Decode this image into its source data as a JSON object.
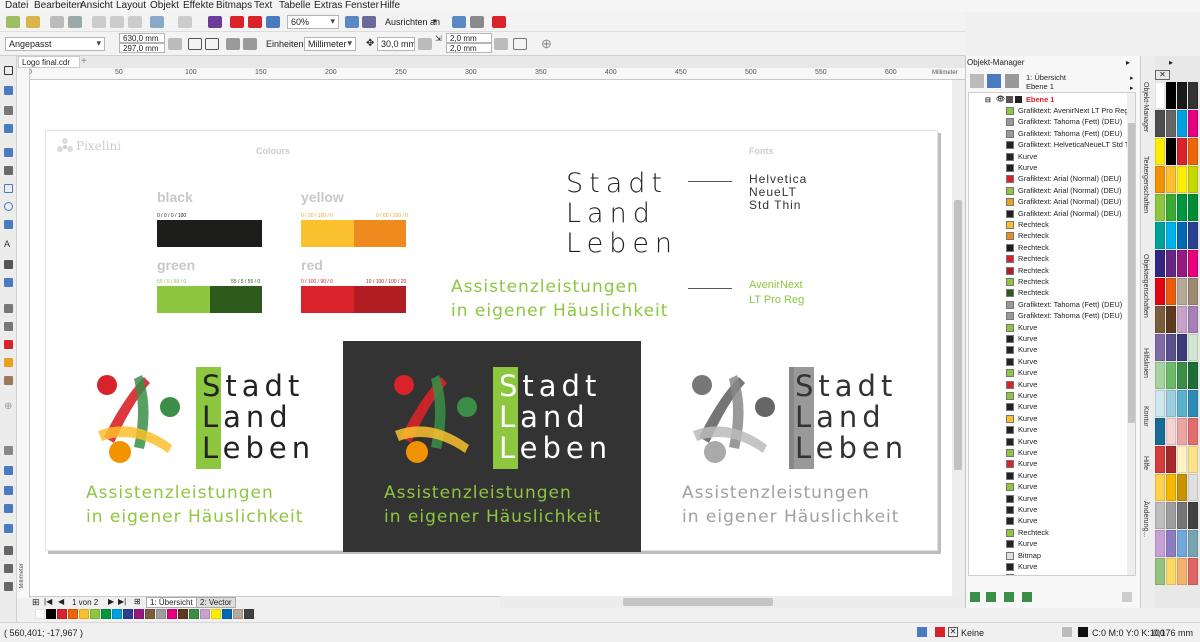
{
  "menu": [
    "Datei",
    "Bearbeiten",
    "Ansicht",
    "Layout",
    "Objekt",
    "Effekte",
    "Bitmaps",
    "Text",
    "Tabelle",
    "Extras",
    "Fenster",
    "Hilfe"
  ],
  "toolbar": {
    "zoom": "60%",
    "align": "Ausrichten an"
  },
  "propbar": {
    "preset": "Angepasst",
    "width": "630,0 mm",
    "height": "297,0 mm",
    "units_label": "Einheiten:",
    "units": "Millimeter",
    "nudge": "30,0 mm",
    "dup_x": "2,0 mm",
    "dup_y": "2,0 mm"
  },
  "doc_tab": "Logo final.cdr",
  "ruler": {
    "ticks": [
      "0",
      "50",
      "100",
      "150",
      "200",
      "250",
      "300",
      "350",
      "400",
      "450",
      "500",
      "550",
      "600"
    ],
    "unit": "Millimeter",
    "vunit": "Millimeter"
  },
  "pagenav": {
    "count": "1 von 2",
    "page1": "1: Übersicht",
    "page2": "2: Vector"
  },
  "status": {
    "coords": "( 560,401; -17,967 )",
    "fill_none": "Keine",
    "cmyk": "C:0 M:0 Y:0 K:100",
    "outline": "0,176 mm"
  },
  "sheet": {
    "brand": "Pixelini",
    "colours_title": "Colours",
    "fonts_title": "Fonts",
    "colours": [
      {
        "name": "black",
        "code1": "0 / 0 / 0 / 100",
        "code2": "",
        "c1": "#1d1d1b",
        "c2": "#1d1d1b",
        "codecolor": "#222"
      },
      {
        "name": "yellow",
        "code1": "0 / 20 / 100 / 0",
        "code2": "0 / 60 / 100 / 0",
        "c1": "#fbc02d",
        "c2": "#ef8a1f",
        "codecolor": "#e9a21f"
      },
      {
        "name": "green",
        "code1": "55 / 0 / 90 / 0",
        "code2": "55 / 5 / 55 / 0",
        "c1": "#8dc63f",
        "c2": "#2d5a1b",
        "codecolor": "#8dc63f"
      },
      {
        "name": "red",
        "code1": "0 / 100 / 90 / 0",
        "code2": "10 / 100 / 100 / 20",
        "c1": "#d8232a",
        "c2": "#b01e23",
        "codecolor": "#d8232a"
      }
    ],
    "logo_lines": [
      "Stadt",
      "Land",
      "Leben"
    ],
    "font1": [
      "Helvetica",
      "NeueLT",
      "Std Thin"
    ],
    "tagline": [
      "Assistenzleistungen",
      "in eigener Häuslichkeit"
    ],
    "font2": [
      "AvenirNext",
      "LT Pro Reg"
    ],
    "green": "#8dc63f",
    "gray": "#a0a0a0"
  },
  "object_manager": {
    "title": "Objekt-Manager",
    "page": "1: Übersicht",
    "layer": "Ebene 1",
    "layer_label": "Ebene 1",
    "items": [
      {
        "label": "Grafiktext: AvenirNext LT Pro Reg",
        "icon": "#8dc63f"
      },
      {
        "label": "Grafiktext: Tahoma (Fett) (DEU)",
        "icon": "#999"
      },
      {
        "label": "Grafiktext: Tahoma (Fett) (DEU)",
        "icon": "#999"
      },
      {
        "label": "Grafiktext: HelveticaNeueLT Std Th",
        "icon": "#222"
      },
      {
        "label": "Kurve",
        "icon": "#222"
      },
      {
        "label": "Kurve",
        "icon": "#222"
      },
      {
        "label": "Grafiktext: Arial (Normal) (DEU)",
        "icon": "#d8232a"
      },
      {
        "label": "Grafiktext: Arial (Normal) (DEU)",
        "icon": "#8dc63f"
      },
      {
        "label": "Grafiktext: Arial (Normal) (DEU)",
        "icon": "#e9a21f"
      },
      {
        "label": "Grafiktext: Arial (Normal) (DEU)",
        "icon": "#222"
      },
      {
        "label": "Rechteck",
        "icon": "#fbc02d"
      },
      {
        "label": "Rechteck",
        "icon": "#ef8a1f"
      },
      {
        "label": "Rechteck",
        "icon": "#1d1d1b"
      },
      {
        "label": "Rechteck",
        "icon": "#d8232a"
      },
      {
        "label": "Rechteck",
        "icon": "#b01e23"
      },
      {
        "label": "Rechteck",
        "icon": "#8dc63f"
      },
      {
        "label": "Rechteck",
        "icon": "#2d5a1b"
      },
      {
        "label": "Grafiktext: Tahoma (Fett) (DEU)",
        "icon": "#999"
      },
      {
        "label": "Grafiktext: Tahoma (Fett) (DEU)",
        "icon": "#999"
      },
      {
        "label": "Kurve",
        "icon": "#8dc63f"
      },
      {
        "label": "Kurve",
        "icon": "#222"
      },
      {
        "label": "Kurve",
        "icon": "#222"
      },
      {
        "label": "Kurve",
        "icon": "#222"
      },
      {
        "label": "Kurve",
        "icon": "#8dc63f"
      },
      {
        "label": "Kurve",
        "icon": "#d8232a"
      },
      {
        "label": "Kurve",
        "icon": "#8dc63f"
      },
      {
        "label": "Kurve",
        "icon": "#222"
      },
      {
        "label": "Kurve",
        "icon": "#fbc02d"
      },
      {
        "label": "Kurve",
        "icon": "#222"
      },
      {
        "label": "Kurve",
        "icon": "#222"
      },
      {
        "label": "Kurve",
        "icon": "#8dc63f"
      },
      {
        "label": "Kurve",
        "icon": "#d8232a"
      },
      {
        "label": "Kurve",
        "icon": "#222"
      },
      {
        "label": "Kurve",
        "icon": "#8dc63f"
      },
      {
        "label": "Kurve",
        "icon": "#222"
      },
      {
        "label": "Kurve",
        "icon": "#222"
      },
      {
        "label": "Kurve",
        "icon": "#222"
      },
      {
        "label": "Rechteck",
        "icon": "#8dc63f"
      },
      {
        "label": "Kurve",
        "icon": "#222"
      },
      {
        "label": "Bitmap",
        "icon": "#ddd"
      },
      {
        "label": "Kurve",
        "icon": "#222"
      },
      {
        "label": "Kurve",
        "icon": "#222"
      }
    ]
  },
  "dock_tabs": [
    "Objekt-Manager",
    "Textergenschaften",
    "Objekteigenschaften",
    "Hilfslinien",
    "Kontur",
    "Hilfe",
    "Änderung..."
  ],
  "palette_colors": [
    "#ffffff",
    "#000000",
    "#1a1a1a",
    "#333333",
    "#4d4d4d",
    "#666666",
    "#00a0e3",
    "#e5007d",
    "#ffed00",
    "#000000",
    "#d8232a",
    "#ec6608",
    "#f39200",
    "#fbc02d",
    "#ffed00",
    "#c6d800",
    "#8dc63f",
    "#3aaa35",
    "#009640",
    "#008d36",
    "#00a19a",
    "#00b1eb",
    "#0069b4",
    "#2a4190",
    "#312783",
    "#662483",
    "#951b81",
    "#e6007e",
    "#e30613",
    "#ea5b0c",
    "#b5a99a",
    "#9d8a71",
    "#7a5e3c",
    "#5b3a1e",
    "#c8a2c8",
    "#a57fb8",
    "#7f6ba4",
    "#5a4f8f",
    "#3b3a7a",
    "#d1e7d1",
    "#a6d4a0",
    "#6cb96a",
    "#3a8e48",
    "#1f6d37",
    "#cfe8f0",
    "#99cfe0",
    "#5ab0cf",
    "#2d8bb5",
    "#186c93",
    "#f7d4d4",
    "#eea3a3",
    "#e36d6d",
    "#d43d3d",
    "#a52a2a",
    "#fff3c4",
    "#ffe38a",
    "#ffd24d",
    "#f5b800",
    "#c89200",
    "#e0e0e0",
    "#bdbdbd",
    "#9e9e9e",
    "#757575",
    "#424242",
    "#c7a1d6",
    "#8e7cc3",
    "#6fa8dc",
    "#76a5af",
    "#93c47d",
    "#ffd966",
    "#f6b26b",
    "#e06666",
    "#cc4125",
    "#a61c00"
  ],
  "bottom_palette": [
    "#ffffff",
    "#000000",
    "#d8232a",
    "#ec6608",
    "#fbc02d",
    "#8dc63f",
    "#009640",
    "#00a0e3",
    "#2a4190",
    "#951b81",
    "#7a5e3c",
    "#9e9e9e",
    "#e6007e",
    "#5b3a1e",
    "#3a8e48",
    "#c8a2c8",
    "#ffed00",
    "#0069b4",
    "#b5a99a",
    "#424242"
  ]
}
